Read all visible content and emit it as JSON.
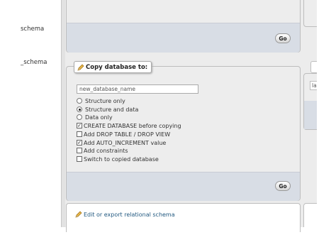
{
  "sidebar": {
    "items": [
      {
        "label": "schema"
      },
      {
        "label": "_schema"
      }
    ]
  },
  "top_panel": {
    "go_label": "Go"
  },
  "copy_db": {
    "legend": "Copy database to:",
    "input_value": "new_database_name",
    "options": [
      {
        "label": "Structure only",
        "type": "radio",
        "checked": false
      },
      {
        "label": "Structure and data",
        "type": "radio",
        "checked": true
      },
      {
        "label": "Data only",
        "type": "radio",
        "checked": false
      },
      {
        "label": "CREATE DATABASE before copying",
        "type": "checkbox",
        "checked": true
      },
      {
        "label": "Add DROP TABLE / DROP VIEW",
        "type": "checkbox",
        "checked": false
      },
      {
        "label": "Add AUTO_INCREMENT value",
        "type": "checkbox",
        "checked": true
      },
      {
        "label": "Add constraints",
        "type": "checkbox",
        "checked": false
      },
      {
        "label": "Switch to copied database",
        "type": "checkbox",
        "checked": false
      }
    ],
    "go_label": "Go"
  },
  "relational_link": {
    "label": "Edit or export relational schema",
    "icon": "pencil-icon"
  },
  "right_fragment": {
    "input_value": "la"
  },
  "colors": {
    "link": "#235a81",
    "footer_bg": "#d8dde5",
    "panel_bg": "#ededed",
    "content_bg": "#ececec"
  }
}
